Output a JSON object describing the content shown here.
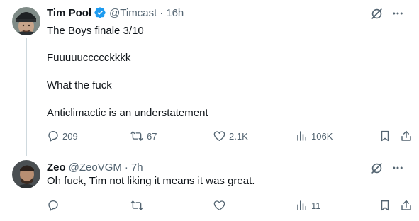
{
  "tweets": [
    {
      "name": "Tim Pool",
      "handle": "@Timcast",
      "time": "16h",
      "verified": true,
      "lines": [
        "The Boys finale 3/10",
        "Fuuuuuccccckkkk",
        "What the fuck",
        "Anticlimactic is an understatement"
      ],
      "replies": "209",
      "retweets": "67",
      "likes": "2.1K",
      "views": "106K"
    },
    {
      "name": "Zeo",
      "handle": "@ZeoVGM",
      "time": "7h",
      "verified": false,
      "lines": [
        "Oh fuck, Tim not liking it means it was great."
      ],
      "replies": "",
      "retweets": "",
      "likes": "",
      "views": "11"
    }
  ],
  "separator": "·",
  "colors": {
    "verified": "#1d9bf0",
    "muted": "#536471",
    "text": "#0f1419",
    "thread_line": "#cfd9de"
  },
  "icons": [
    "verified-badge-icon",
    "grok-icon",
    "more-icon",
    "reply-icon",
    "retweet-icon",
    "like-icon",
    "views-icon",
    "bookmark-icon",
    "share-icon"
  ]
}
